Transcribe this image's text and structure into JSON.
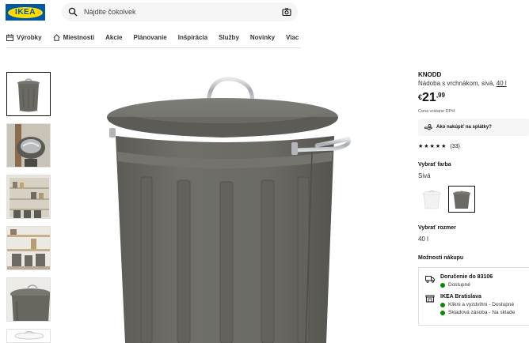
{
  "header": {
    "logo_text": "IKEA",
    "search_placeholder": "Nájdite čokolvek"
  },
  "nav": {
    "items": [
      {
        "label": "Výrobky",
        "icon": "calendar-grid-icon"
      },
      {
        "label": "Miestnosti",
        "icon": "home-icon"
      },
      {
        "label": "Akcie"
      },
      {
        "label": "Plánovanie"
      },
      {
        "label": "Inšpirácia"
      },
      {
        "label": "Služby"
      },
      {
        "label": "Novinky"
      },
      {
        "label": "Viac"
      }
    ]
  },
  "product": {
    "name": "KNODD",
    "description": "Nádoba s vrchnákom, sivá,",
    "size_link": "40 l",
    "price_currency": "€",
    "price_main": "21",
    "price_decimal": ",99",
    "vat_note": "Cena vrátane DPH",
    "installment_label": "Ako nakúpiť na splátky?",
    "rating": {
      "stars": 5,
      "count_label": "(33)"
    }
  },
  "color": {
    "title": "Vybrať farba",
    "selected": "Sivá",
    "options": [
      "white",
      "gray"
    ]
  },
  "size": {
    "title": "Vybrať rozmer",
    "selected": "40 l"
  },
  "purchase": {
    "title": "Možnosti nákupu",
    "delivery_title": "Doručenie do 83106",
    "delivery_status": "Dostupné",
    "store_title": "IKEA Bratislava",
    "store_status_1": "Klikni a vyzdvihni - Dostupné",
    "store_status_2": "Skladová zásoba - Na sklade"
  },
  "colors": {
    "ikea_blue": "#0058a3",
    "ikea_yellow": "#ffdb00",
    "bin_gray": "#6a6964",
    "available_green": "#0a8a00"
  }
}
